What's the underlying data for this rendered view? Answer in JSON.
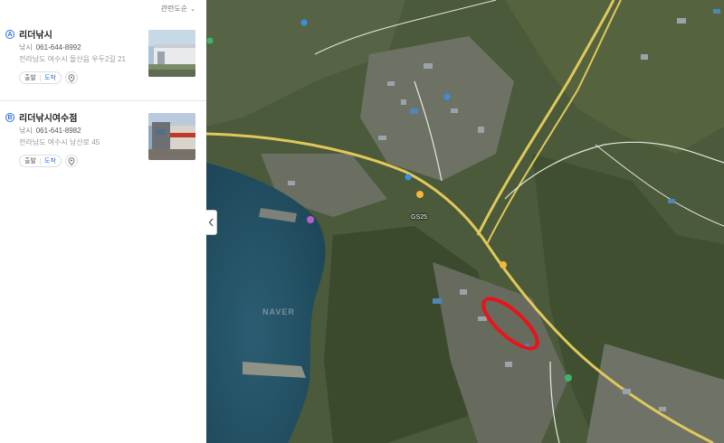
{
  "sort": {
    "label": "관련도순"
  },
  "results": [
    {
      "marker": "A",
      "name": "리더낚시",
      "category": "낚시",
      "phone": "061-644-8992",
      "address": "전라남도 여수시 돌산읍 우두2길 21",
      "depart_label": "출발",
      "arrive_label": "도착"
    },
    {
      "marker": "B",
      "name": "리더낚시여수점",
      "category": "낚시",
      "phone": "061-641-8982",
      "address": "전라남도 여수시 남산로 45",
      "depart_label": "출발",
      "arrive_label": "도착"
    }
  ],
  "map": {
    "labels": {
      "gas_station": "GS25",
      "watermark": "NAVER"
    },
    "highlight_color": "#e8141b",
    "road_color": "#e0c85a"
  }
}
